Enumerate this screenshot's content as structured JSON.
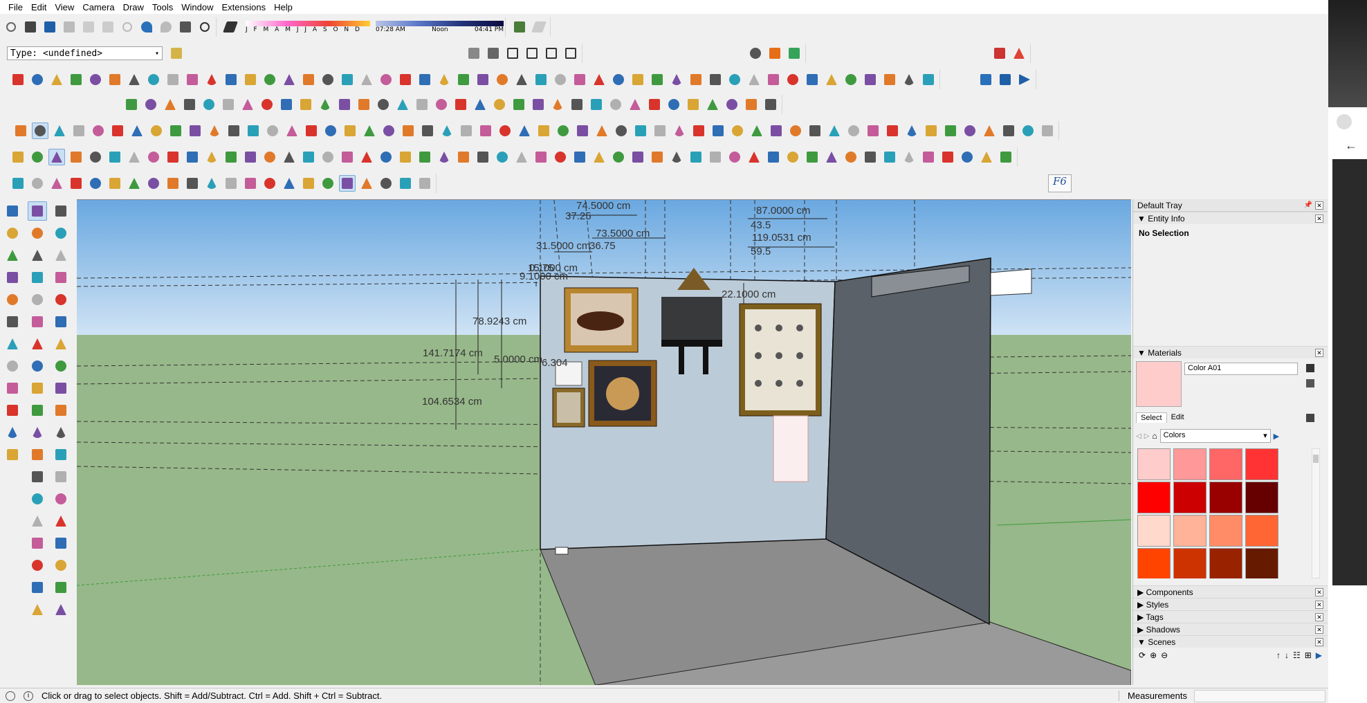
{
  "menu": [
    "File",
    "Edit",
    "View",
    "Camera",
    "Draw",
    "Tools",
    "Window",
    "Extensions",
    "Help"
  ],
  "shadow": {
    "months": "J F M A M J J A S O N D",
    "time_start": "07:28 AM",
    "time_mid": "Noon",
    "time_end": "04:41 PM"
  },
  "type_box": "Type: <undefined>",
  "viewport": {
    "dimensions": [
      "74.5000 cm",
      "37.25",
      "73.5000 cm",
      "36.75",
      "31.5000 cm",
      "15.75",
      "0.1000 cm",
      "9.1000 cm",
      "87.0000 cm",
      "43.5",
      "119.0531 cm",
      "59.5",
      "22.1000 cm",
      "78.9243 cm",
      "141.7174 cm",
      "5.0000 cm",
      "6.304",
      "104.6534 cm"
    ]
  },
  "tray": {
    "title": "Default Tray",
    "entity_info": {
      "title": "Entity Info",
      "value": "No Selection"
    },
    "materials": {
      "title": "Materials",
      "current": "Color A01",
      "tab_select": "Select",
      "tab_edit": "Edit",
      "library": "Colors",
      "current_color": "#ffcccc",
      "swatches": [
        "#ffcccc",
        "#ff9999",
        "#ff6666",
        "#ff3333",
        "#ff0000",
        "#cc0000",
        "#990000",
        "#660000",
        "#ffd9cc",
        "#ffb399",
        "#ff8c66",
        "#ff6633",
        "#ff4400",
        "#cc3300",
        "#992200",
        "#661a00"
      ]
    },
    "collapsed_panels": [
      "Components",
      "Styles",
      "Tags",
      "Shadows"
    ],
    "scenes": {
      "title": "Scenes"
    }
  },
  "status": {
    "hint": "Click or drag to select objects. Shift = Add/Subtract. Ctrl = Add. Shift + Ctrl = Subtract.",
    "measurements_label": "Measurements"
  },
  "toolbar_f6": "F6"
}
